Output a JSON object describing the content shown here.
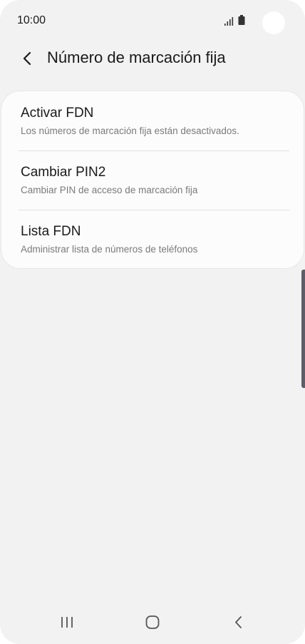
{
  "status_bar": {
    "time": "10:00",
    "icons": [
      "signal-icon",
      "battery-icon"
    ]
  },
  "header": {
    "back_icon": "chevron-left-icon",
    "title": "Número de marcación fija"
  },
  "settings": {
    "items": [
      {
        "title": "Activar FDN",
        "subtitle": "Los números de marcación fija están desactivados."
      },
      {
        "title": "Cambiar PIN2",
        "subtitle": "Cambiar PIN de acceso de marcación fija"
      },
      {
        "title": "Lista FDN",
        "subtitle": "Administrar lista de números de teléfonos"
      }
    ]
  },
  "nav_bar": {
    "icons": [
      "recent-apps-icon",
      "home-icon",
      "back-icon"
    ]
  },
  "colors": {
    "background": "#f2f2f2",
    "card": "#fcfcfc",
    "text_primary": "#1a1a1a",
    "text_secondary": "#7a7a7a",
    "scroll_handle": "#5e5d68"
  }
}
